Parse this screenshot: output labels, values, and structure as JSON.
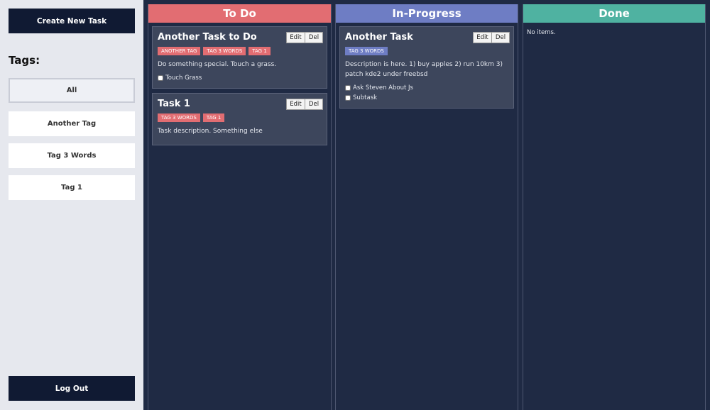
{
  "sidebar": {
    "create_label": "Create New Task",
    "tags_heading": "Tags:",
    "tag_filters": [
      "All",
      "Another Tag",
      "Tag 3 Words",
      "Tag 1"
    ],
    "logout_label": "Log Out"
  },
  "columns": {
    "todo": {
      "title": "To Do",
      "color": "#e26d72",
      "cards": [
        {
          "title": "Another Task to Do",
          "edit": "Edit",
          "del": "Del",
          "tags": [
            "ANOTHER TAG",
            "TAG 3 WORDS",
            "TAG 1"
          ],
          "description": "Do something special. Touch a grass.",
          "subtasks": [
            "Touch Grass"
          ]
        },
        {
          "title": "Task 1",
          "edit": "Edit",
          "del": "Del",
          "tags": [
            "TAG 3 WORDS",
            "TAG 1"
          ],
          "description": "Task description. Something else",
          "subtasks": []
        }
      ]
    },
    "progress": {
      "title": "In-Progress",
      "color": "#6e7dc4",
      "cards": [
        {
          "title": "Another Task",
          "edit": "Edit",
          "del": "Del",
          "tags": [
            "TAG 3 WORDS"
          ],
          "description": "Description is here. 1) buy apples 2) run 10km 3) patch kde2 under freebsd",
          "subtasks": [
            "Ask Steven About Js",
            "Subtask"
          ]
        }
      ]
    },
    "done": {
      "title": "Done",
      "color": "#4fb2a1",
      "empty_text": "No items."
    }
  }
}
